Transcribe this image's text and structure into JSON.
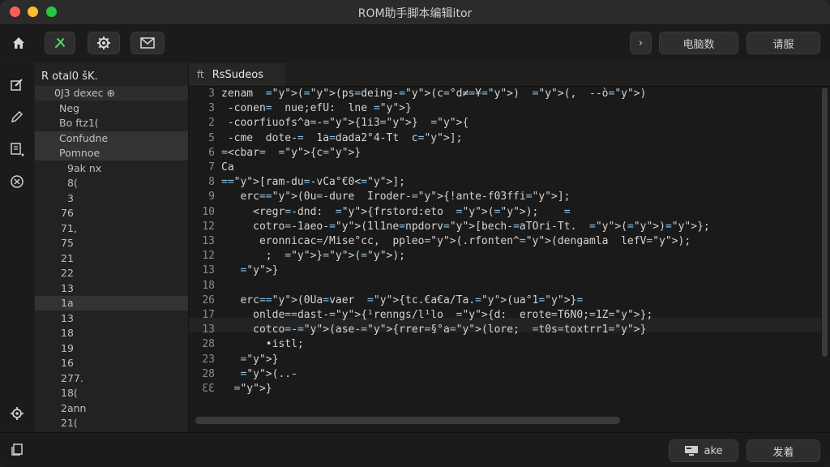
{
  "window": {
    "title": "ROM助手脚本编辑itor"
  },
  "toolbar": {
    "right_buttons": [
      "电脑数",
      "请服"
    ],
    "chevron": "›"
  },
  "sidebar": {
    "header": "R otal0 šK.",
    "items": [
      {
        "label": "0J3  dexec ⊕",
        "indent": 24
      },
      {
        "label": "Neg",
        "indent": 30
      },
      {
        "label": "Bo  ftz1(",
        "indent": 30
      },
      {
        "label": "Confudne",
        "indent": 30
      },
      {
        "label": "Pomnoe",
        "indent": 30
      },
      {
        "label": "9ak nx",
        "indent": 40
      },
      {
        "label": "8(",
        "indent": 40
      },
      {
        "label": "3",
        "indent": 40
      },
      {
        "label": "76",
        "indent": 32
      },
      {
        "label": "71,",
        "indent": 32
      },
      {
        "label": "75",
        "indent": 32
      },
      {
        "label": "21",
        "indent": 32
      },
      {
        "label": "22",
        "indent": 32
      },
      {
        "label": "13",
        "indent": 32
      },
      {
        "label": "1a",
        "indent": 32
      },
      {
        "label": "13",
        "indent": 32
      },
      {
        "label": "18",
        "indent": 32
      },
      {
        "label": "19",
        "indent": 32
      },
      {
        "label": "16",
        "indent": 32
      },
      {
        "label": "277.",
        "indent": 32
      },
      {
        "label": "18(",
        "indent": 32
      },
      {
        "label": "2ann",
        "indent": 32
      },
      {
        "label": "21(",
        "indent": 32
      }
    ]
  },
  "editor": {
    "tab_label": "RsSudeos",
    "tab_icon": "ft",
    "lines": [
      {
        "n": "3",
        "text": "zenam  ((ps=deing-(c=°d≠=¥)  (,  --ò)"
      },
      {
        "n": "3",
        "text": " -conen=  nue;efU:  lne }"
      },
      {
        "n": "2",
        "text": " -coorfiuofs^a=-{1i3}  {"
      },
      {
        "n": "5",
        "text": " -cme  dote-=  1a=dada2°4-Tt  c];"
      },
      {
        "n": "6",
        "text": "=<cbar=  {c}"
      },
      {
        "n": "7",
        "text": "Ca"
      },
      {
        "n": "8",
        "text": "=[ram-du=-vCa°€0<];"
      },
      {
        "n": "9",
        "text": "   erc=(0u=-dure  Iroder-{!ante-f03ffi];"
      },
      {
        "n": "10",
        "text": "     <regr=-dnd:  {frstord:eto  ();    ="
      },
      {
        "n": "12",
        "text": "     cotro=-1aeo-(1l1ne=npdorv[bech-=aTOri-Tt.  ()};"
      },
      {
        "n": "13",
        "text": "      eronnicac=/Mise°cc,  ppleo(.rfonten^(dengamla  lefV);"
      },
      {
        "n": "12",
        "text": "       ;  }();"
      },
      {
        "n": "13",
        "text": "   }"
      },
      {
        "n": "18",
        "text": ""
      },
      {
        "n": "26",
        "text": "   erc=(0Ua=vaer  {tc.€a€a/Ta.(ua°1}="
      },
      {
        "n": "17",
        "text": "     onlde==dast-{¹renngs/l¹lo  {d:  erote=T6N0;=1Z};"
      },
      {
        "n": "13",
        "text": "     cotco=-(ase-{rrer=§°a(lore;  =t0s=toxtrr1}"
      },
      {
        "n": "28",
        "text": "       •istl;"
      },
      {
        "n": "23",
        "text": "   }"
      },
      {
        "n": "28",
        "text": "   (..-"
      },
      {
        "n": "ƐƐ",
        "text": "  }"
      }
    ]
  },
  "bottombar": {
    "buttons": [
      "ake",
      "发着"
    ]
  },
  "colors": {
    "accent": "#28c840",
    "background": "#1a1a1a"
  }
}
